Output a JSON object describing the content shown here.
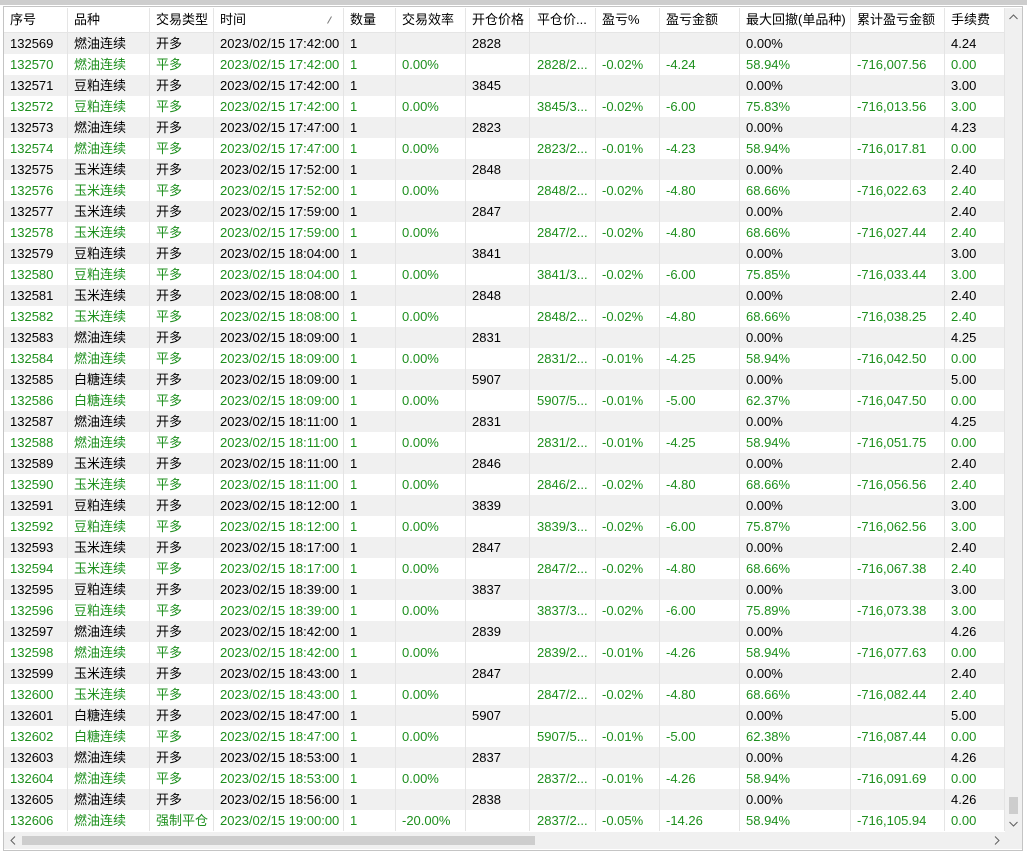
{
  "columns": [
    "序号",
    "品种",
    "交易类型",
    "时间",
    "数量",
    "交易效率",
    "开仓价格",
    "平仓价...",
    "盈亏%",
    "盈亏金额",
    "最大回撤(单品种)",
    "累计盈亏金额",
    "手续费"
  ],
  "rows": [
    [
      "132569",
      "燃油连续",
      "开多",
      "2023/02/15 17:42:00",
      "1",
      "",
      "2828",
      "",
      "",
      "",
      "0.00%",
      "",
      "4.24"
    ],
    [
      "132570",
      "燃油连续",
      "平多",
      "2023/02/15 17:42:00",
      "1",
      "0.00%",
      "",
      "2828/2...",
      "-0.02%",
      "-4.24",
      "58.94%",
      "-716,007.56",
      "0.00"
    ],
    [
      "132571",
      "豆粕连续",
      "开多",
      "2023/02/15 17:42:00",
      "1",
      "",
      "3845",
      "",
      "",
      "",
      "0.00%",
      "",
      "3.00"
    ],
    [
      "132572",
      "豆粕连续",
      "平多",
      "2023/02/15 17:42:00",
      "1",
      "0.00%",
      "",
      "3845/3...",
      "-0.02%",
      "-6.00",
      "75.83%",
      "-716,013.56",
      "3.00"
    ],
    [
      "132573",
      "燃油连续",
      "开多",
      "2023/02/15 17:47:00",
      "1",
      "",
      "2823",
      "",
      "",
      "",
      "0.00%",
      "",
      "4.23"
    ],
    [
      "132574",
      "燃油连续",
      "平多",
      "2023/02/15 17:47:00",
      "1",
      "0.00%",
      "",
      "2823/2...",
      "-0.01%",
      "-4.23",
      "58.94%",
      "-716,017.81",
      "0.00"
    ],
    [
      "132575",
      "玉米连续",
      "开多",
      "2023/02/15 17:52:00",
      "1",
      "",
      "2848",
      "",
      "",
      "",
      "0.00%",
      "",
      "2.40"
    ],
    [
      "132576",
      "玉米连续",
      "平多",
      "2023/02/15 17:52:00",
      "1",
      "0.00%",
      "",
      "2848/2...",
      "-0.02%",
      "-4.80",
      "68.66%",
      "-716,022.63",
      "2.40"
    ],
    [
      "132577",
      "玉米连续",
      "开多",
      "2023/02/15 17:59:00",
      "1",
      "",
      "2847",
      "",
      "",
      "",
      "0.00%",
      "",
      "2.40"
    ],
    [
      "132578",
      "玉米连续",
      "平多",
      "2023/02/15 17:59:00",
      "1",
      "0.00%",
      "",
      "2847/2...",
      "-0.02%",
      "-4.80",
      "68.66%",
      "-716,027.44",
      "2.40"
    ],
    [
      "132579",
      "豆粕连续",
      "开多",
      "2023/02/15 18:04:00",
      "1",
      "",
      "3841",
      "",
      "",
      "",
      "0.00%",
      "",
      "3.00"
    ],
    [
      "132580",
      "豆粕连续",
      "平多",
      "2023/02/15 18:04:00",
      "1",
      "0.00%",
      "",
      "3841/3...",
      "-0.02%",
      "-6.00",
      "75.85%",
      "-716,033.44",
      "3.00"
    ],
    [
      "132581",
      "玉米连续",
      "开多",
      "2023/02/15 18:08:00",
      "1",
      "",
      "2848",
      "",
      "",
      "",
      "0.00%",
      "",
      "2.40"
    ],
    [
      "132582",
      "玉米连续",
      "平多",
      "2023/02/15 18:08:00",
      "1",
      "0.00%",
      "",
      "2848/2...",
      "-0.02%",
      "-4.80",
      "68.66%",
      "-716,038.25",
      "2.40"
    ],
    [
      "132583",
      "燃油连续",
      "开多",
      "2023/02/15 18:09:00",
      "1",
      "",
      "2831",
      "",
      "",
      "",
      "0.00%",
      "",
      "4.25"
    ],
    [
      "132584",
      "燃油连续",
      "平多",
      "2023/02/15 18:09:00",
      "1",
      "0.00%",
      "",
      "2831/2...",
      "-0.01%",
      "-4.25",
      "58.94%",
      "-716,042.50",
      "0.00"
    ],
    [
      "132585",
      "白糖连续",
      "开多",
      "2023/02/15 18:09:00",
      "1",
      "",
      "5907",
      "",
      "",
      "",
      "0.00%",
      "",
      "5.00"
    ],
    [
      "132586",
      "白糖连续",
      "平多",
      "2023/02/15 18:09:00",
      "1",
      "0.00%",
      "",
      "5907/5...",
      "-0.01%",
      "-5.00",
      "62.37%",
      "-716,047.50",
      "0.00"
    ],
    [
      "132587",
      "燃油连续",
      "开多",
      "2023/02/15 18:11:00",
      "1",
      "",
      "2831",
      "",
      "",
      "",
      "0.00%",
      "",
      "4.25"
    ],
    [
      "132588",
      "燃油连续",
      "平多",
      "2023/02/15 18:11:00",
      "1",
      "0.00%",
      "",
      "2831/2...",
      "-0.01%",
      "-4.25",
      "58.94%",
      "-716,051.75",
      "0.00"
    ],
    [
      "132589",
      "玉米连续",
      "开多",
      "2023/02/15 18:11:00",
      "1",
      "",
      "2846",
      "",
      "",
      "",
      "0.00%",
      "",
      "2.40"
    ],
    [
      "132590",
      "玉米连续",
      "平多",
      "2023/02/15 18:11:00",
      "1",
      "0.00%",
      "",
      "2846/2...",
      "-0.02%",
      "-4.80",
      "68.66%",
      "-716,056.56",
      "2.40"
    ],
    [
      "132591",
      "豆粕连续",
      "开多",
      "2023/02/15 18:12:00",
      "1",
      "",
      "3839",
      "",
      "",
      "",
      "0.00%",
      "",
      "3.00"
    ],
    [
      "132592",
      "豆粕连续",
      "平多",
      "2023/02/15 18:12:00",
      "1",
      "0.00%",
      "",
      "3839/3...",
      "-0.02%",
      "-6.00",
      "75.87%",
      "-716,062.56",
      "3.00"
    ],
    [
      "132593",
      "玉米连续",
      "开多",
      "2023/02/15 18:17:00",
      "1",
      "",
      "2847",
      "",
      "",
      "",
      "0.00%",
      "",
      "2.40"
    ],
    [
      "132594",
      "玉米连续",
      "平多",
      "2023/02/15 18:17:00",
      "1",
      "0.00%",
      "",
      "2847/2...",
      "-0.02%",
      "-4.80",
      "68.66%",
      "-716,067.38",
      "2.40"
    ],
    [
      "132595",
      "豆粕连续",
      "开多",
      "2023/02/15 18:39:00",
      "1",
      "",
      "3837",
      "",
      "",
      "",
      "0.00%",
      "",
      "3.00"
    ],
    [
      "132596",
      "豆粕连续",
      "平多",
      "2023/02/15 18:39:00",
      "1",
      "0.00%",
      "",
      "3837/3...",
      "-0.02%",
      "-6.00",
      "75.89%",
      "-716,073.38",
      "3.00"
    ],
    [
      "132597",
      "燃油连续",
      "开多",
      "2023/02/15 18:42:00",
      "1",
      "",
      "2839",
      "",
      "",
      "",
      "0.00%",
      "",
      "4.26"
    ],
    [
      "132598",
      "燃油连续",
      "平多",
      "2023/02/15 18:42:00",
      "1",
      "0.00%",
      "",
      "2839/2...",
      "-0.01%",
      "-4.26",
      "58.94%",
      "-716,077.63",
      "0.00"
    ],
    [
      "132599",
      "玉米连续",
      "开多",
      "2023/02/15 18:43:00",
      "1",
      "",
      "2847",
      "",
      "",
      "",
      "0.00%",
      "",
      "2.40"
    ],
    [
      "132600",
      "玉米连续",
      "平多",
      "2023/02/15 18:43:00",
      "1",
      "0.00%",
      "",
      "2847/2...",
      "-0.02%",
      "-4.80",
      "68.66%",
      "-716,082.44",
      "2.40"
    ],
    [
      "132601",
      "白糖连续",
      "开多",
      "2023/02/15 18:47:00",
      "1",
      "",
      "5907",
      "",
      "",
      "",
      "0.00%",
      "",
      "5.00"
    ],
    [
      "132602",
      "白糖连续",
      "平多",
      "2023/02/15 18:47:00",
      "1",
      "0.00%",
      "",
      "5907/5...",
      "-0.01%",
      "-5.00",
      "62.38%",
      "-716,087.44",
      "0.00"
    ],
    [
      "132603",
      "燃油连续",
      "开多",
      "2023/02/15 18:53:00",
      "1",
      "",
      "2837",
      "",
      "",
      "",
      "0.00%",
      "",
      "4.26"
    ],
    [
      "132604",
      "燃油连续",
      "平多",
      "2023/02/15 18:53:00",
      "1",
      "0.00%",
      "",
      "2837/2...",
      "-0.01%",
      "-4.26",
      "58.94%",
      "-716,091.69",
      "0.00"
    ],
    [
      "132605",
      "燃油连续",
      "开多",
      "2023/02/15 18:56:00",
      "1",
      "",
      "2838",
      "",
      "",
      "",
      "0.00%",
      "",
      "4.26"
    ],
    [
      "132606",
      "燃油连续",
      "强制平仓",
      "2023/02/15 19:00:00",
      "1",
      "-20.00%",
      "",
      "2837/2...",
      "-0.05%",
      "-14.26",
      "58.94%",
      "-716,105.94",
      "0.00"
    ]
  ],
  "colors": {
    "open_text": "#000000",
    "close_text": "#1d8f1d",
    "alt_row_bg": "#f0f0f0"
  },
  "icons": {
    "time_sort": "sort-indicator-icon",
    "scroll_up": "chevron-up-icon",
    "scroll_down": "chevron-down-icon",
    "scroll_left": "chevron-left-icon",
    "scroll_right": "chevron-right-icon"
  }
}
